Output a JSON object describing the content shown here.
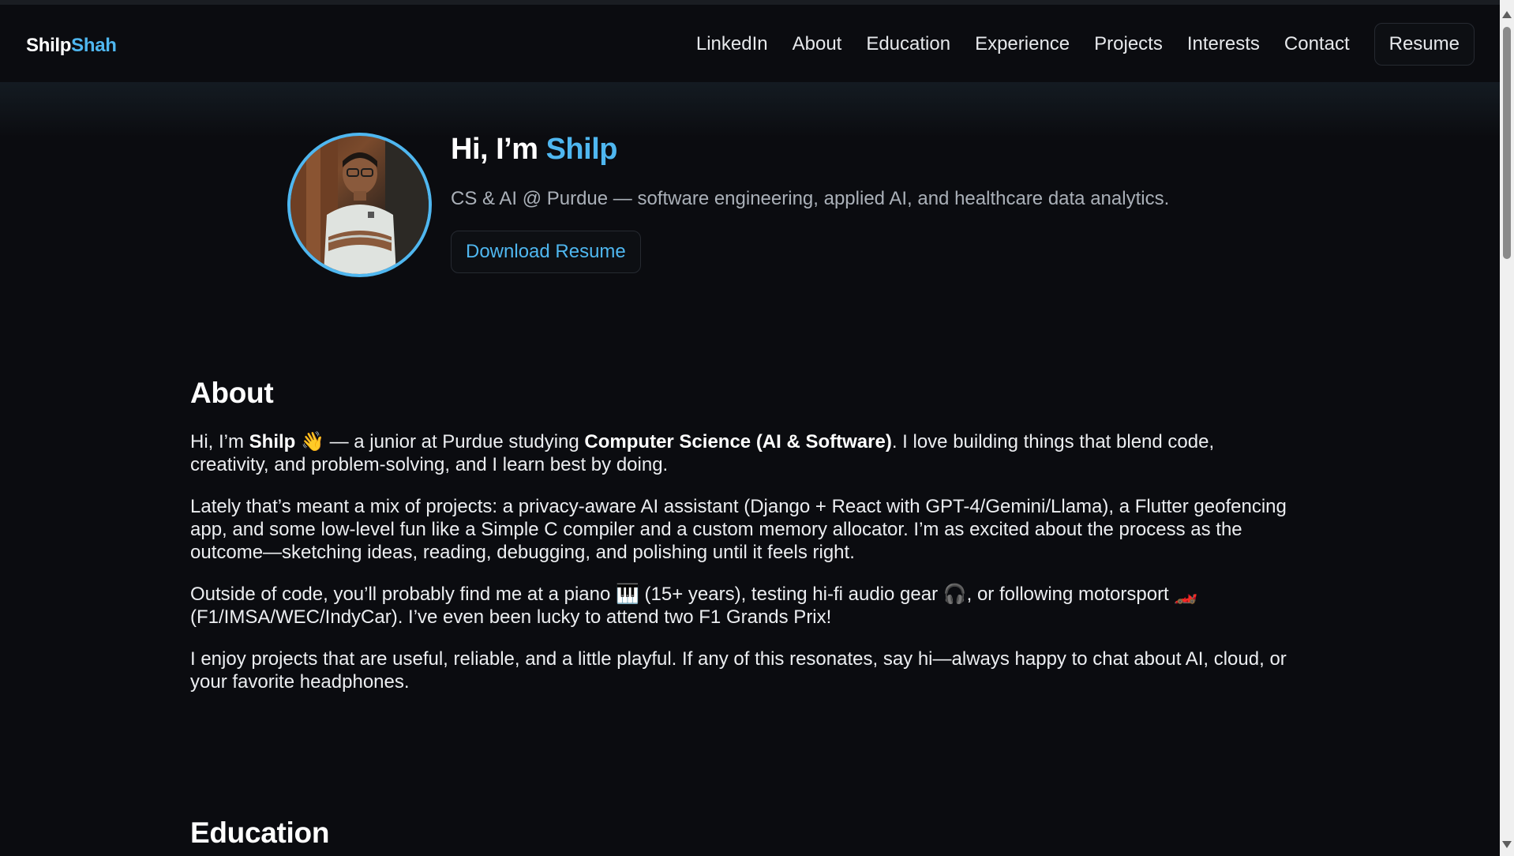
{
  "brand": {
    "first": "Shilp",
    "last": "Shah"
  },
  "nav": {
    "links": [
      "LinkedIn",
      "About",
      "Education",
      "Experience",
      "Projects",
      "Interests",
      "Contact"
    ],
    "resume": "Resume"
  },
  "hero": {
    "greeting": "Hi, I’m ",
    "name": "Shilp",
    "subtitle": "CS & AI @ Purdue — software engineering, applied AI, and healthcare data analytics.",
    "download_label": "Download Resume"
  },
  "about": {
    "title": "About",
    "p1_a": "Hi, I’m ",
    "p1_name": "Shilp",
    "p1_b": " 👋 — a junior at Purdue studying ",
    "p1_major": "Computer Science (AI & Software)",
    "p1_c": ". I love building things that blend code, creativity, and problem-solving, and I learn best by doing.",
    "p2": "Lately that’s meant a mix of projects: a privacy-aware AI assistant (Django + React with GPT-4/Gemini/Llama), a Flutter geofencing app, and some low-level fun like a Simple C compiler and a custom memory allocator. I’m as excited about the process as the outcome—sketching ideas, reading, debugging, and polishing until it feels right.",
    "p3": "Outside of code, you’ll probably find me at a piano 🎹 (15+ years), testing hi-fi audio gear 🎧, or following motorsport 🏎️ (F1/IMSA/WEC/IndyCar). I’ve even been lucky to attend two F1 Grands Prix!",
    "p4": "I enjoy projects that are useful, reliable, and a little playful. If any of this resonates, say hi—always happy to chat about AI, cloud, or your favorite headphones."
  },
  "education": {
    "title": "Education"
  },
  "colors": {
    "accent": "#4fb7f0",
    "background": "#0b0c10",
    "text": "#e8eaed"
  }
}
